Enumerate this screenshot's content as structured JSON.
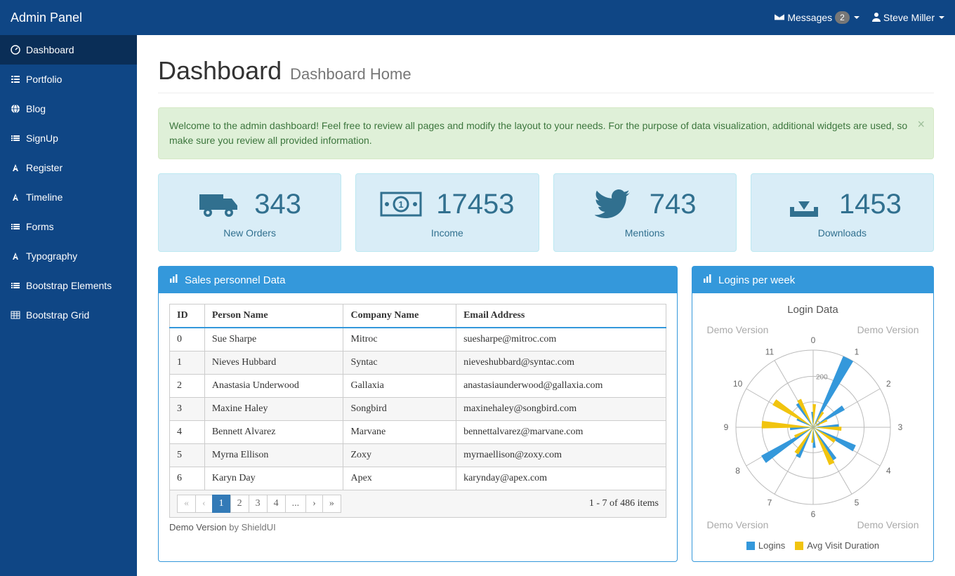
{
  "topbar": {
    "brand": "Admin Panel",
    "messages_label": "Messages",
    "messages_count": "2",
    "user_name": "Steve Miller"
  },
  "sidebar": {
    "items": [
      {
        "label": "Dashboard",
        "icon": "dashboard",
        "active": true
      },
      {
        "label": "Portfolio",
        "icon": "th-list",
        "active": false
      },
      {
        "label": "Blog",
        "icon": "globe",
        "active": false
      },
      {
        "label": "SignUp",
        "icon": "list-alt",
        "active": false
      },
      {
        "label": "Register",
        "icon": "font",
        "active": false
      },
      {
        "label": "Timeline",
        "icon": "font",
        "active": false
      },
      {
        "label": "Forms",
        "icon": "list-alt",
        "active": false
      },
      {
        "label": "Typography",
        "icon": "font",
        "active": false
      },
      {
        "label": "Bootstrap Elements",
        "icon": "list-alt",
        "active": false
      },
      {
        "label": "Bootstrap Grid",
        "icon": "table",
        "active": false
      }
    ]
  },
  "header": {
    "title": "Dashboard",
    "subtitle": "Dashboard Home"
  },
  "alert": {
    "text": "Welcome to the admin dashboard! Feel free to review all pages and modify the layout to your needs. For the purpose of data visualization, additional widgets are used, so make sure you review all provided information."
  },
  "stats": [
    {
      "value": "343",
      "label": "New Orders",
      "icon": "truck"
    },
    {
      "value": "17453",
      "label": "Income",
      "icon": "money"
    },
    {
      "value": "743",
      "label": "Mentions",
      "icon": "twitter"
    },
    {
      "value": "1453",
      "label": "Downloads",
      "icon": "download"
    }
  ],
  "sales_panel": {
    "title": "Sales personnel Data",
    "columns": [
      "ID",
      "Person Name",
      "Company Name",
      "Email Address"
    ],
    "rows": [
      [
        "0",
        "Sue Sharpe",
        "Mitroc",
        "suesharpe@mitroc.com"
      ],
      [
        "1",
        "Nieves Hubbard",
        "Syntac",
        "nieveshubbard@syntac.com"
      ],
      [
        "2",
        "Anastasia Underwood",
        "Gallaxia",
        "anastasiaunderwood@gallaxia.com"
      ],
      [
        "3",
        "Maxine Haley",
        "Songbird",
        "maxinehaley@songbird.com"
      ],
      [
        "4",
        "Bennett Alvarez",
        "Marvane",
        "bennettalvarez@marvane.com"
      ],
      [
        "5",
        "Myrna Ellison",
        "Zoxy",
        "myrnaellison@zoxy.com"
      ],
      [
        "6",
        "Karyn Day",
        "Apex",
        "karynday@apex.com"
      ]
    ],
    "pager": {
      "buttons": [
        "«",
        "‹",
        "1",
        "2",
        "3",
        "4",
        "...",
        "›",
        "»"
      ],
      "active_index": 2,
      "info": "1 - 7 of 486 items"
    },
    "demo_note_strong": "Demo Version",
    "demo_note_rest": " by ShieldUI"
  },
  "logins_panel": {
    "title": "Logins per week",
    "chart_title": "Login Data",
    "watermark": "Demo Version",
    "legend": [
      {
        "label": "Logins",
        "color": "#3498db"
      },
      {
        "label": "Avg Visit Duration",
        "color": "#f1c40f"
      }
    ],
    "radial_ticks": [
      "0",
      "200"
    ]
  },
  "chart_data": {
    "type": "bar",
    "categories": [
      "0",
      "1",
      "2",
      "3",
      "4",
      "5",
      "6",
      "7",
      "8",
      "9",
      "10",
      "11"
    ],
    "series": [
      {
        "name": "Logins",
        "values": [
          60,
          300,
          140,
          100,
          180,
          150,
          80,
          130,
          230,
          90,
          70,
          110
        ]
      },
      {
        "name": "Avg Visit Duration",
        "values": [
          90,
          70,
          60,
          110,
          100,
          160,
          60,
          120,
          80,
          200,
          180,
          120
        ]
      }
    ],
    "title": "Login Data",
    "ylim": [
      0,
      300
    ],
    "layout": "polar"
  },
  "colors": {
    "brand_dark": "#0f4685",
    "panel_blue": "#3498db",
    "info_bg": "#d9edf7",
    "yellow": "#f1c40f"
  }
}
